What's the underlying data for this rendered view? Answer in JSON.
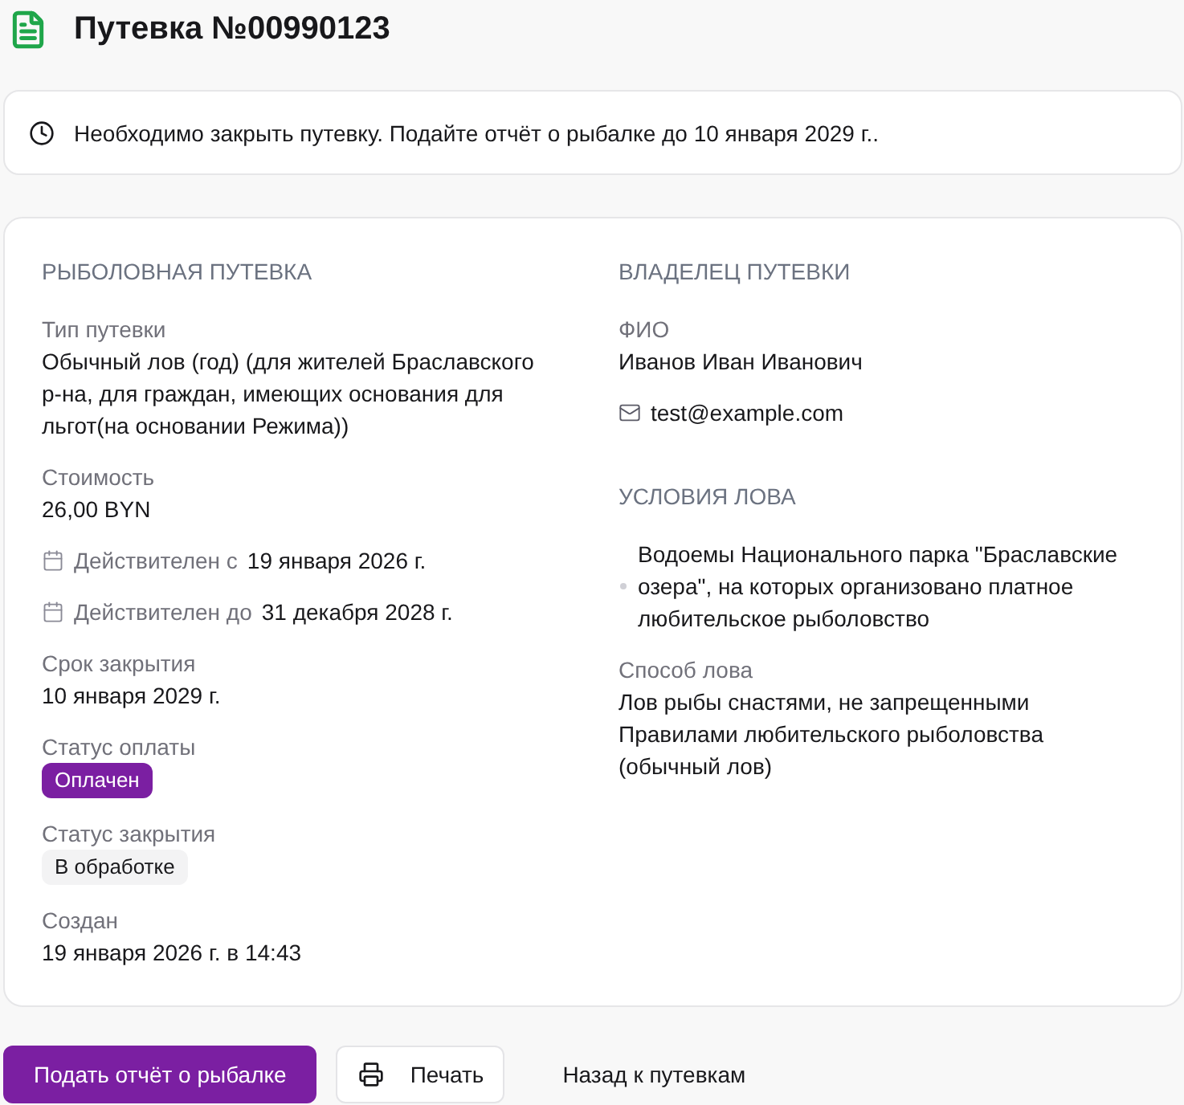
{
  "header": {
    "title": "Путевка №00990123"
  },
  "notice": {
    "text": "Необходимо закрыть путевку. Подайте отчёт о рыбалке до 10 января 2029 г.."
  },
  "permit": {
    "heading": "РЫБОЛОВНАЯ ПУТЕВКА",
    "fields": [
      {
        "kind": "text",
        "label": "Тип путевки",
        "value": "Обычный лов (год) (для жителей Браславского р-на, для граждан, имеющих основания для льгот(на основании Режима))"
      },
      {
        "kind": "text",
        "label": "Стоимость",
        "value": "26,00 BYN"
      },
      {
        "kind": "date",
        "label": "Действителен с",
        "value": "19 января 2026 г."
      },
      {
        "kind": "date",
        "label": "Действителен до",
        "value": "31 декабря 2028 г."
      },
      {
        "kind": "text",
        "label": "Срок закрытия",
        "value": "10 января 2029 г."
      },
      {
        "kind": "badge",
        "label": "Статус оплаты",
        "value": "Оплачен",
        "color": "#7b1fa2"
      },
      {
        "kind": "badge",
        "label": "Статус закрытия",
        "value": "В обработке",
        "color": "#f3f3f4"
      },
      {
        "kind": "text",
        "label": "Создан",
        "value": "19 января 2026 г. в 14:43"
      }
    ]
  },
  "owner": {
    "heading": "ВЛАДЕЛЕЦ ПУТЕВКИ",
    "fields": [
      {
        "kind": "text",
        "label": "ФИО",
        "value": "Иванов Иван Иванович"
      },
      {
        "kind": "email",
        "value": "test@example.com"
      }
    ]
  },
  "conditions": {
    "heading": "УСЛОВИЯ ЛОВА",
    "waters": [
      "Водоемы Национального парка \"Браславские озера\", на которых организовано платное любительское рыболовство"
    ],
    "fields": [
      {
        "kind": "text",
        "label": "Способ лова",
        "value": "Лов рыбы снастями, не запрещенными Правилами любительского рыболовства (обычный лов)"
      }
    ]
  },
  "actions": [
    {
      "kind": "primary",
      "label": "Подать отчёт о рыбалке"
    },
    {
      "kind": "secondary",
      "label": "Печать"
    },
    {
      "kind": "text",
      "label": "Назад к путевкам"
    }
  ]
}
